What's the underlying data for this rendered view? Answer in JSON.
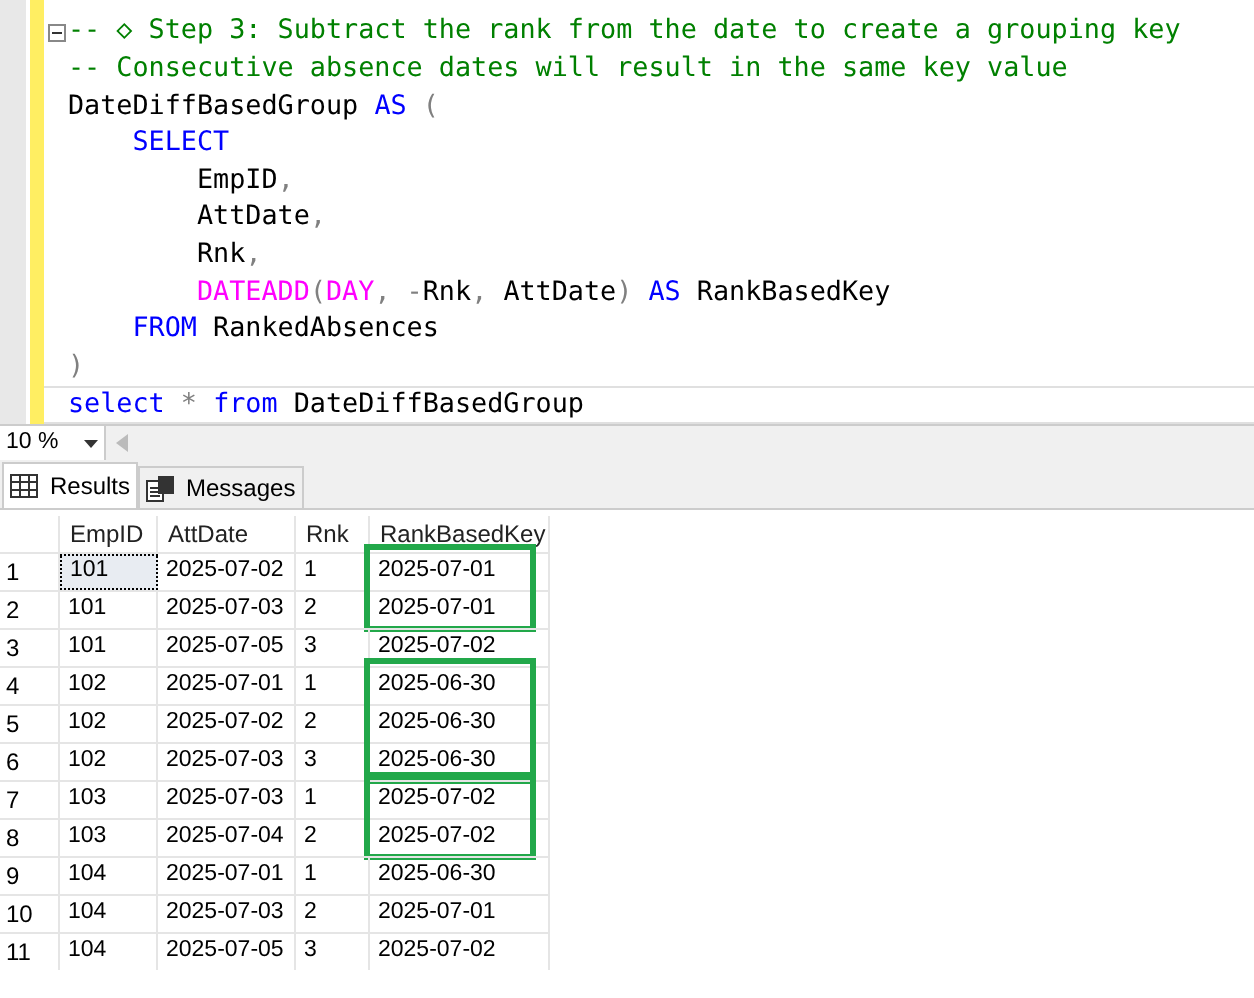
{
  "editor": {
    "lines": [
      {
        "collapsible": true,
        "current": false,
        "tokens": [
          {
            "kind": "comment",
            "text": "-- ◇ Step 3: Subtract the rank from the date to create a grouping key"
          }
        ]
      },
      {
        "collapsible": false,
        "current": false,
        "tokens": [
          {
            "kind": "comment",
            "text": "-- Consecutive absence dates will result in the same key value"
          }
        ]
      },
      {
        "collapsible": false,
        "current": false,
        "tokens": [
          {
            "kind": "plain",
            "text": "DateDiffBasedGroup "
          },
          {
            "kind": "keyword",
            "text": "AS"
          },
          {
            "kind": "operator",
            "text": " ("
          }
        ]
      },
      {
        "collapsible": false,
        "current": false,
        "tokens": [
          {
            "kind": "keyword",
            "text": "    SELECT"
          }
        ]
      },
      {
        "collapsible": false,
        "current": false,
        "tokens": [
          {
            "kind": "plain",
            "text": "        EmpID"
          },
          {
            "kind": "operator",
            "text": ","
          }
        ]
      },
      {
        "collapsible": false,
        "current": false,
        "tokens": [
          {
            "kind": "plain",
            "text": "        AttDate"
          },
          {
            "kind": "operator",
            "text": ","
          }
        ]
      },
      {
        "collapsible": false,
        "current": false,
        "tokens": [
          {
            "kind": "plain",
            "text": "        Rnk"
          },
          {
            "kind": "operator",
            "text": ","
          }
        ]
      },
      {
        "collapsible": false,
        "current": false,
        "tokens": [
          {
            "kind": "function",
            "text": "        DATEADD"
          },
          {
            "kind": "operator",
            "text": "("
          },
          {
            "kind": "function",
            "text": "DAY"
          },
          {
            "kind": "operator",
            "text": ", -"
          },
          {
            "kind": "plain",
            "text": "Rnk"
          },
          {
            "kind": "operator",
            "text": ", "
          },
          {
            "kind": "plain",
            "text": "AttDate"
          },
          {
            "kind": "operator",
            "text": ") "
          },
          {
            "kind": "keyword",
            "text": "AS"
          },
          {
            "kind": "plain",
            "text": " RankBasedKey"
          }
        ]
      },
      {
        "collapsible": false,
        "current": false,
        "tokens": [
          {
            "kind": "keyword",
            "text": "    FROM"
          },
          {
            "kind": "plain",
            "text": " RankedAbsences"
          }
        ]
      },
      {
        "collapsible": false,
        "current": false,
        "tokens": [
          {
            "kind": "operator",
            "text": ")"
          }
        ]
      },
      {
        "collapsible": false,
        "current": true,
        "tokens": [
          {
            "kind": "keyword",
            "text": "select"
          },
          {
            "kind": "operator",
            "text": " * "
          },
          {
            "kind": "keyword",
            "text": "from"
          },
          {
            "kind": "plain",
            "text": " DateDiffBasedGroup"
          }
        ]
      }
    ]
  },
  "zoom": {
    "value": "10 %"
  },
  "tabs": [
    {
      "label": "Results",
      "selected": true,
      "kind": "grid"
    },
    {
      "label": "Messages",
      "selected": false,
      "kind": "messages"
    }
  ],
  "table": {
    "columns": [
      "EmpID",
      "AttDate",
      "Rnk",
      "RankBasedKey"
    ],
    "row_groups": [
      {
        "boxed": true,
        "rows": [
          {
            "num": "1",
            "selected": true,
            "cells": [
              "101",
              "2025-07-02",
              "1",
              "2025-07-01"
            ]
          },
          {
            "num": "2",
            "selected": false,
            "cells": [
              "101",
              "2025-07-03",
              "2",
              "2025-07-01"
            ]
          }
        ]
      },
      {
        "boxed": false,
        "rows": [
          {
            "num": "3",
            "selected": false,
            "cells": [
              "101",
              "2025-07-05",
              "3",
              "2025-07-02"
            ]
          }
        ]
      },
      {
        "boxed": true,
        "rows": [
          {
            "num": "4",
            "selected": false,
            "cells": [
              "102",
              "2025-07-01",
              "1",
              "2025-06-30"
            ]
          },
          {
            "num": "5",
            "selected": false,
            "cells": [
              "102",
              "2025-07-02",
              "2",
              "2025-06-30"
            ]
          },
          {
            "num": "6",
            "selected": false,
            "cells": [
              "102",
              "2025-07-03",
              "3",
              "2025-06-30"
            ]
          }
        ]
      },
      {
        "boxed": true,
        "rows": [
          {
            "num": "7",
            "selected": false,
            "cells": [
              "103",
              "2025-07-03",
              "1",
              "2025-07-02"
            ]
          },
          {
            "num": "8",
            "selected": false,
            "cells": [
              "103",
              "2025-07-04",
              "2",
              "2025-07-02"
            ]
          }
        ]
      },
      {
        "boxed": false,
        "rows": [
          {
            "num": "9",
            "selected": false,
            "cells": [
              "104",
              "2025-07-01",
              "1",
              "2025-06-30"
            ]
          },
          {
            "num": "10",
            "selected": false,
            "cells": [
              "104",
              "2025-07-03",
              "2",
              "2025-07-01"
            ]
          },
          {
            "num": "11",
            "selected": false,
            "cells": [
              "104",
              "2025-07-05",
              "3",
              "2025-07-02"
            ]
          }
        ]
      }
    ]
  }
}
